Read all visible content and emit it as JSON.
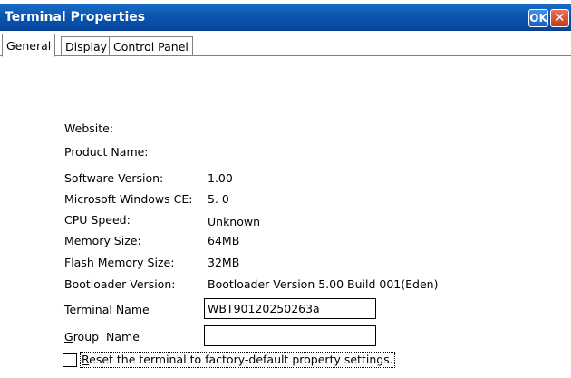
{
  "window": {
    "title": "Terminal Properties",
    "ok_label": "OK",
    "close_label": "✕"
  },
  "tabs": [
    {
      "label": "General",
      "active": true
    },
    {
      "label": "Display",
      "active": false
    },
    {
      "label": "Control Panel",
      "active": false
    }
  ],
  "general": {
    "website_label": "Website:",
    "product_name_label": "Product Name:",
    "software_version_label": "Software Version:",
    "software_version_value": "1.00",
    "windows_ce_label": "Microsoft Windows CE:",
    "windows_ce_value": "5. 0",
    "cpu_speed_label": "CPU Speed:",
    "cpu_speed_value": "Unknown",
    "memory_size_label": "Memory Size:",
    "memory_size_value": "64MB",
    "flash_memory_label": "Flash Memory Size:",
    "flash_memory_value": "32MB",
    "bootloader_label": "Bootloader Version:",
    "bootloader_value": "Bootloader Version 5.00 Build 001(Eden)",
    "terminal_name_label_pre": "Terminal ",
    "terminal_name_label_ul": "N",
    "terminal_name_label_post": "ame",
    "terminal_name_value": "WBT90120250263a",
    "group_name_label_ul": "G",
    "group_name_label_post": "roup  Name",
    "group_name_value": "",
    "reset_label_ul": "R",
    "reset_label_post": "eset the terminal to factory-default property settings.",
    "reset_checked": false
  },
  "colors": {
    "titlebar": "#0a54ad",
    "ok_button": "#1c5fc2",
    "close_button": "#c23a1d"
  }
}
